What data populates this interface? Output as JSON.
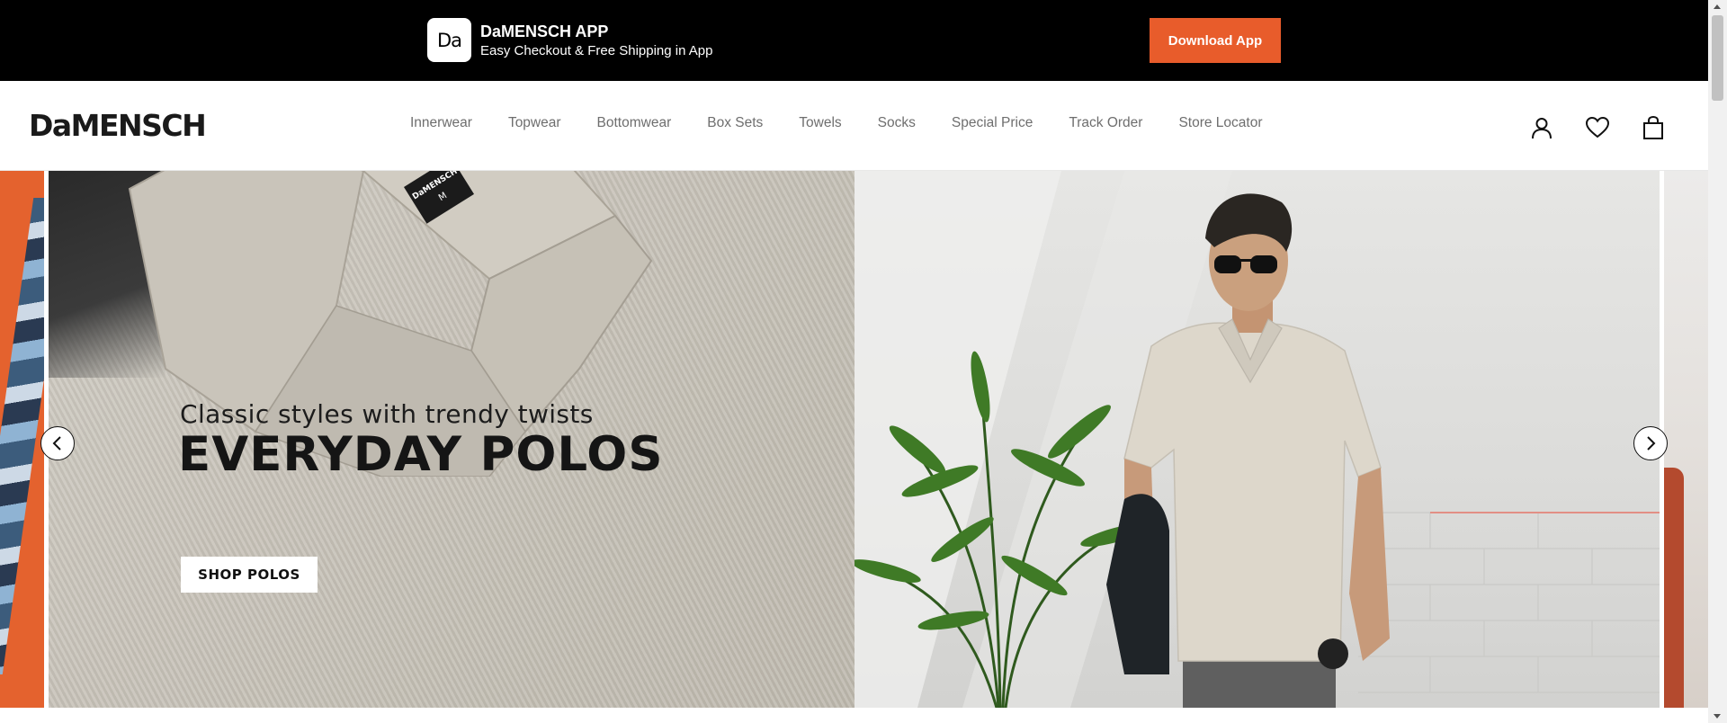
{
  "app_banner": {
    "logo_text": "Da",
    "title": "DaMENSCH APP",
    "subtitle": "Easy Checkout & Free Shipping in App",
    "download_label": "Download App"
  },
  "header": {
    "brand": "DaMENSCH",
    "nav": [
      "Innerwear",
      "Topwear",
      "Bottomwear",
      "Box Sets",
      "Towels",
      "Socks",
      "Special Price",
      "Track Order",
      "Store Locator"
    ],
    "icons": [
      "user-icon",
      "heart-icon",
      "bag-icon"
    ]
  },
  "hero": {
    "tagline": "Classic styles with trendy twists",
    "headline": "EVERYDAY POLOS",
    "cta_label": "SHOP POLOS",
    "tag_brand": "DaMENSCH",
    "tag_size": "M"
  },
  "colors": {
    "accent": "#e85c2b",
    "banner_bg": "#000000",
    "nav_text": "#6e6e6e"
  }
}
